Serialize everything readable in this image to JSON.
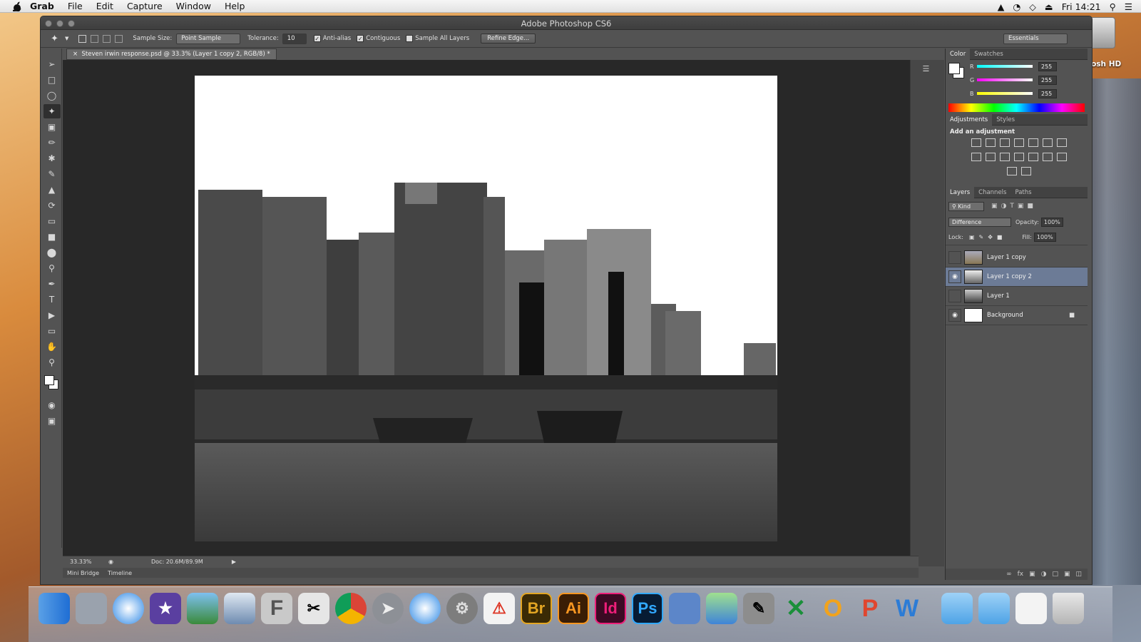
{
  "menubar": {
    "app": "Grab",
    "items": [
      "File",
      "Edit",
      "Capture",
      "Window",
      "Help"
    ],
    "clock": "Fri 14:21"
  },
  "desktop": {
    "hd_label": "intosh HD"
  },
  "window": {
    "title": "Adobe Photoshop CS6"
  },
  "options": {
    "sample_size_label": "Sample Size:",
    "sample_size_value": "Point Sample",
    "tolerance_label": "Tolerance:",
    "tolerance_value": "10",
    "anti_alias": "Anti-alias",
    "contiguous": "Contiguous",
    "sample_all": "Sample All Layers",
    "refine": "Refine Edge...",
    "workspace": "Essentials"
  },
  "document": {
    "tab": "Steven irwin response.psd @ 33.3% (Layer 1 copy 2, RGB/8) *"
  },
  "status": {
    "zoom": "33.33%",
    "doc": "Doc: 20.6M/89.9M"
  },
  "bottom_tabs": [
    "Mini Bridge",
    "Timeline"
  ],
  "color_panel": {
    "tabs": [
      "Color",
      "Swatches"
    ],
    "r_label": "R",
    "g_label": "G",
    "b_label": "B",
    "r": "255",
    "g": "255",
    "b": "255"
  },
  "adjust_panel": {
    "tabs": [
      "Adjustments",
      "Styles"
    ],
    "subtitle": "Add an adjustment"
  },
  "layers_panel": {
    "tabs": [
      "Layers",
      "Channels",
      "Paths"
    ],
    "kind": "Kind",
    "blend": "Difference",
    "opacity_label": "Opacity:",
    "opacity": "100%",
    "lock_label": "Lock:",
    "fill_label": "Fill:",
    "fill": "100%",
    "layers": [
      {
        "name": "Layer 1 copy"
      },
      {
        "name": "Layer 1 copy 2"
      },
      {
        "name": "Layer 1"
      },
      {
        "name": "Background"
      }
    ]
  },
  "dock": {
    "icons": [
      "finder-icon",
      "image-capture-icon",
      "itunes-icon",
      "imovie-icon",
      "iphoto-icon",
      "preview-icon",
      "font-book-icon",
      "scissors-icon",
      "chrome-icon",
      "launchpad-icon",
      "safari-icon",
      "system-preferences-icon",
      "acrobat-icon",
      "bridge-icon",
      "illustrator-icon",
      "indesign-icon",
      "photoshop-icon",
      "keynote-icon",
      "numbers-icon",
      "script-editor-icon",
      "excel-icon",
      "outlook-icon",
      "powerpoint-icon",
      "word-icon",
      "applications-folder-icon",
      "documents-folder-icon",
      "downloads-icon",
      "trash-icon"
    ],
    "br": "Br",
    "ai": "Ai",
    "id": "Id",
    "ps": "Ps"
  },
  "colors": {
    "panel_bg": "#535353",
    "selection": "#6c7b96",
    "canvas_bg": "#282828"
  }
}
